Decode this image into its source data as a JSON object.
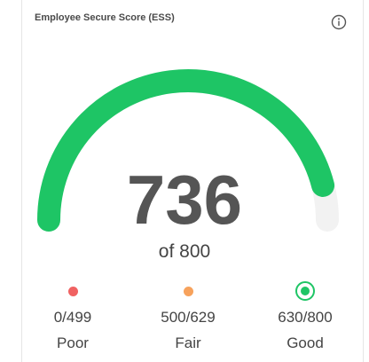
{
  "card": {
    "title": "Employee Secure Score (ESS)",
    "info_icon": "info-icon"
  },
  "gauge": {
    "value": 736,
    "max": 800,
    "score_text": "736",
    "of_text": "of 800",
    "fill_color": "#1ec565",
    "track_color": "#f2f2f2"
  },
  "legend": [
    {
      "range": "0/499",
      "label": "Poor",
      "color": "#f06262",
      "selected": false
    },
    {
      "range": "500/629",
      "label": "Fair",
      "color": "#f7a25c",
      "selected": false
    },
    {
      "range": "630/800",
      "label": "Good",
      "color": "#1ec565",
      "selected": true
    }
  ]
}
